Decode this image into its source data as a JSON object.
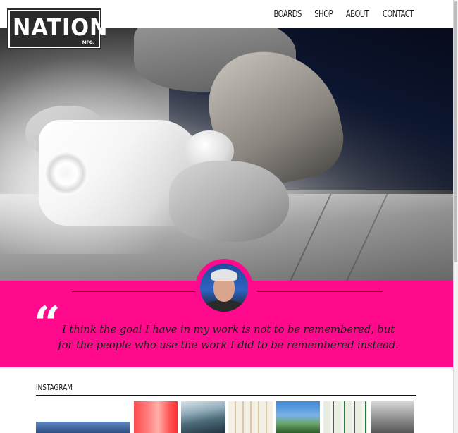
{
  "brand": {
    "name": "NATION",
    "sub": "MFG."
  },
  "nav": [
    "BOARDS",
    "SHOP",
    "ABOUT",
    "CONTACT"
  ],
  "hero": {
    "image": "surfboard-shaping-planer-photo"
  },
  "quote": {
    "mark": "“",
    "line1": "I think the goal I have in my work is not to be remembered, but",
    "line2": "for the people who use the work I did to be remembered instead."
  },
  "instagram": {
    "title": "INSTAGRAM",
    "thumbs": [
      "thumb-beach",
      "thumb-red-boards",
      "thumb-surfer-wave",
      "thumb-board-rack",
      "thumb-field",
      "thumb-white-boards",
      "thumb-people"
    ]
  },
  "colors": {
    "accent": "#ff0a8c",
    "dark": "#2b2b2b",
    "text": "#111111"
  }
}
